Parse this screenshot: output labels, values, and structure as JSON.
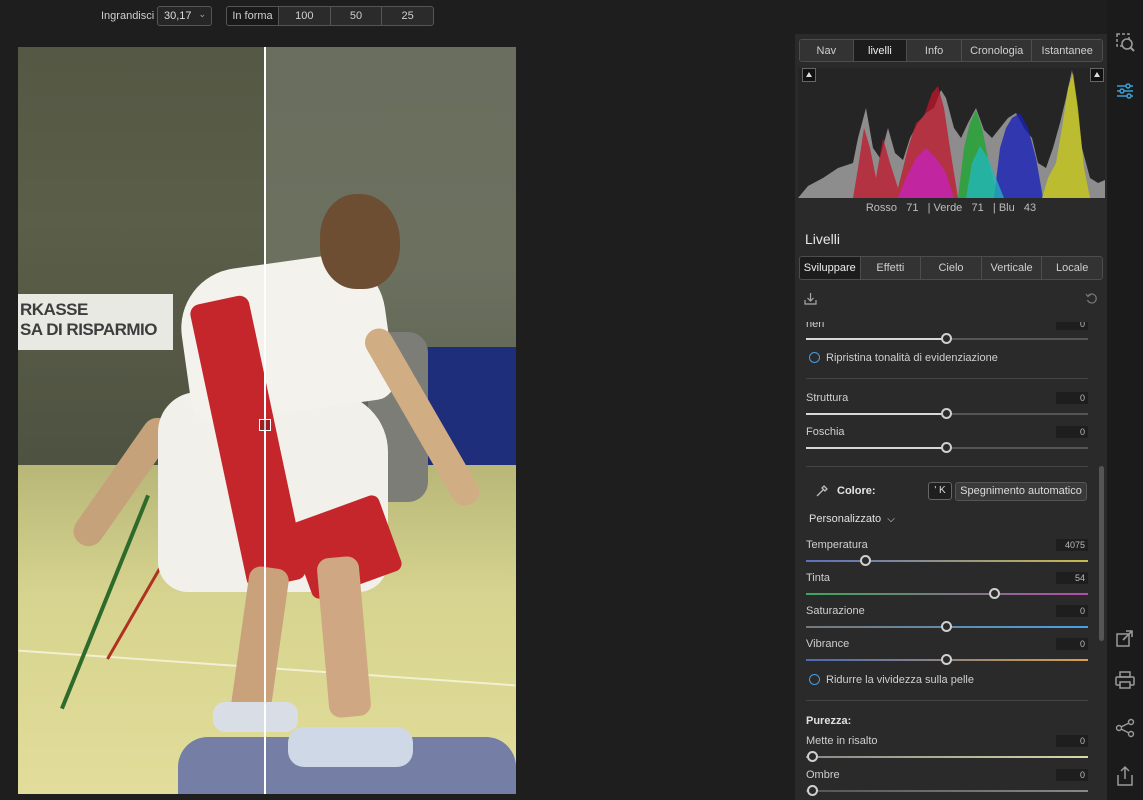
{
  "toolbar": {
    "zoom_label": "Ingrandisci",
    "zoom_value": "30,17",
    "zoom_presets": [
      "In forma",
      "100",
      "50",
      "25"
    ]
  },
  "photo": {
    "banner_line1": "RKASSE",
    "banner_line2": "SA DI RISPARMIO"
  },
  "panel": {
    "tabs": [
      "Nav",
      "livelli",
      "Info",
      "Cronologia",
      "Istantanee"
    ],
    "active_tab": "livelli",
    "histogram": {
      "readout_prefix_r": "Rosso",
      "r": "71",
      "readout_prefix_g": "| Verde",
      "g": "71",
      "readout_prefix_b": "| Blu",
      "b": "43"
    },
    "section_title": "Livelli",
    "dev_tabs": [
      "Sviluppare",
      "Effetti",
      "Cielo",
      "Verticale",
      "Locale"
    ],
    "active_dev_tab": "Sviluppare",
    "controls": {
      "neri": {
        "label": "neri",
        "value": "0",
        "level": 0.5
      },
      "ripristina": "Ripristina tonalità di evidenziazione",
      "struttura": {
        "label": "Struttura",
        "value": "0",
        "level": 0.5
      },
      "foschia": {
        "label": "Foschia",
        "value": "0",
        "level": 0.5
      },
      "colore_header": "Colore:",
      "key_badge": "' K",
      "auto_off": "Spegnimento automatico",
      "preset": "Personalizzato",
      "temperatura": {
        "label": "Temperatura",
        "value": "4075",
        "level": 0.21
      },
      "tinta": {
        "label": "Tinta",
        "value": "54",
        "level": 0.67
      },
      "saturazione": {
        "label": "Saturazione",
        "value": "0",
        "level": 0.5
      },
      "vibrance": {
        "label": "Vibrance",
        "value": "0",
        "level": 0.5
      },
      "ridurre": "Ridurre la vividezza sulla pelle",
      "purezza_header": "Purezza:",
      "mette_in_risalto": {
        "label": "Mette in risalto",
        "value": "0",
        "level": 0.0
      },
      "ombre": {
        "label": "Ombre",
        "value": "0",
        "level": 0.0
      }
    }
  },
  "rail_icons": [
    "zoom-inspect-icon",
    "adjustments-icon",
    "export-icon",
    "print-icon",
    "share-icon",
    "upload-icon"
  ]
}
